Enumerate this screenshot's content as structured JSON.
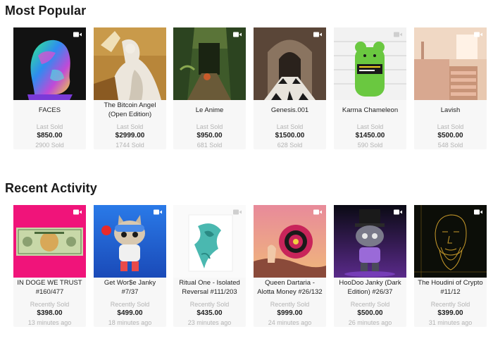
{
  "sections": {
    "popular": {
      "title": "Most Popular",
      "label": "Last Sold",
      "cards": [
        {
          "title": "FACES",
          "price": "$850.00",
          "sub": "2900 Sold",
          "video": true
        },
        {
          "title": "The Bitcoin Angel (Open Edition)",
          "price": "$2999.00",
          "sub": "1744 Sold",
          "video": false
        },
        {
          "title": "Le Anime",
          "price": "$950.00",
          "sub": "681 Sold",
          "video": true
        },
        {
          "title": "Genesis.001",
          "price": "$1500.00",
          "sub": "628 Sold",
          "video": true
        },
        {
          "title": "Karma Chameleon",
          "price": "$1450.00",
          "sub": "590 Sold",
          "video": true
        },
        {
          "title": "Lavish",
          "price": "$500.00",
          "sub": "548 Sold",
          "video": true
        }
      ]
    },
    "recent": {
      "title": "Recent Activity",
      "label": "Recently Sold",
      "cards": [
        {
          "title": "IN DOGE WE TRUST #160/477",
          "price": "$398.00",
          "sub": "13 minutes ago",
          "video": true
        },
        {
          "title": "Get Wor$e Janky #7/37",
          "price": "$499.00",
          "sub": "18 minutes ago",
          "video": true
        },
        {
          "title": "Ritual One - Isolated Reversal #111/203",
          "price": "$435.00",
          "sub": "23 minutes ago",
          "video": true
        },
        {
          "title": "Queen Dartaria - Alotta Money #26/132",
          "price": "$999.00",
          "sub": "24 minutes ago",
          "video": true
        },
        {
          "title": "HooDoo Janky (Dark Edition) #26/37",
          "price": "$500.00",
          "sub": "26 minutes ago",
          "video": true
        },
        {
          "title": "The Houdini of Crypto #11/12",
          "price": "$399.00",
          "sub": "31 minutes ago",
          "video": true
        }
      ]
    }
  },
  "icons": {
    "video": "video-camera-icon"
  }
}
